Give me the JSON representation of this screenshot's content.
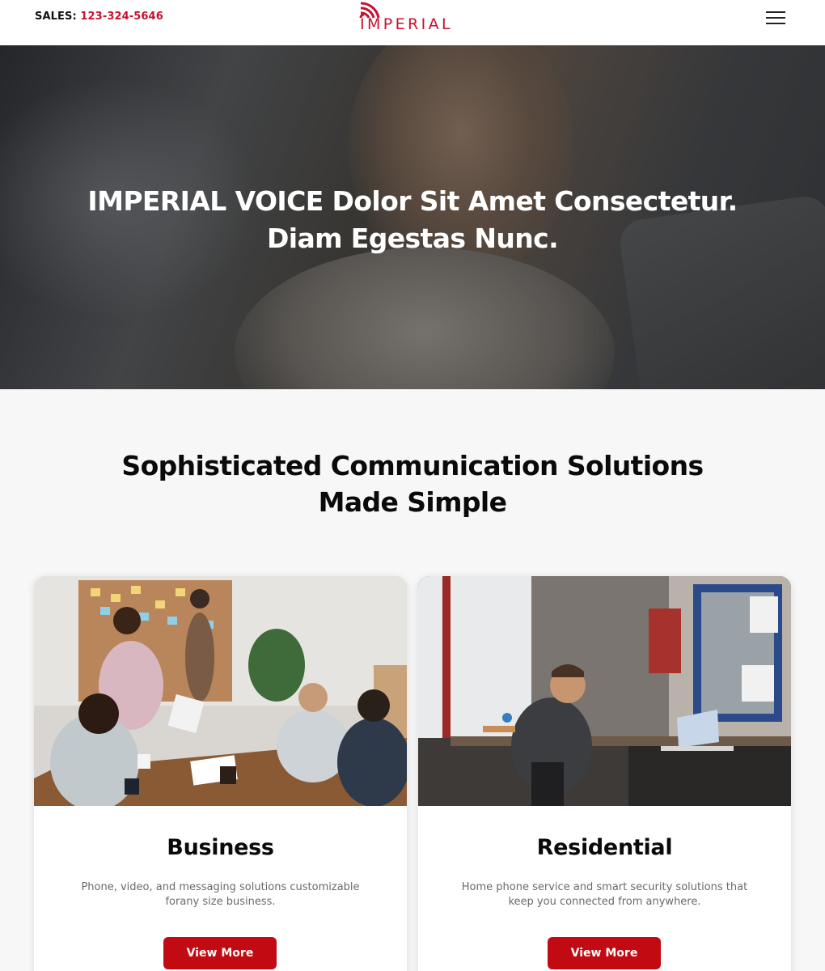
{
  "header": {
    "sales_label": "SALES:",
    "sales_phone": "123-324-5646",
    "logo_text": "IMPERIAL",
    "menu_icon": "hamburger-menu-icon"
  },
  "hero": {
    "headline_line1": "IMPERIAL VOICE Dolor Sit Amet Consectetur.",
    "headline_line2": "Diam Egestas Nunc."
  },
  "section": {
    "title_line1": "Sophisticated Communication Solutions",
    "title_line2": "Made Simple"
  },
  "cards": [
    {
      "title": "Business",
      "description_line1": "Phone, video, and messaging solutions customizable",
      "description_line2": "forany size business.",
      "button_label": "View More"
    },
    {
      "title": "Residential",
      "description_line1": "Home phone service and smart security solutions that",
      "description_line2": "keep you connected from anywhere.",
      "button_label": "View More"
    }
  ],
  "colors": {
    "brand_red": "#c8102e",
    "button_red": "#c20a12",
    "page_bg": "#f7f7f7"
  }
}
